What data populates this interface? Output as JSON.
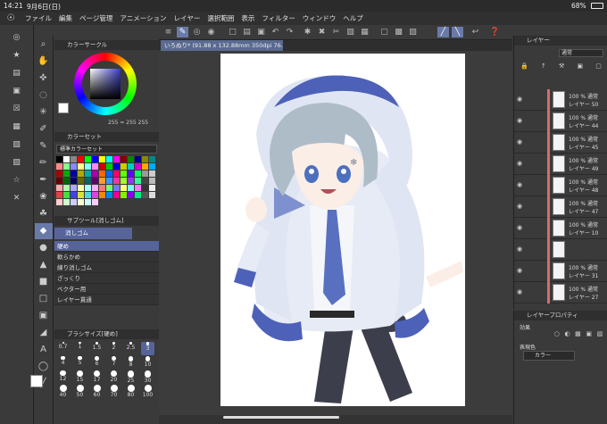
{
  "status": {
    "time": "14:21",
    "date": "9月6日(日)",
    "battery": "68%"
  },
  "menu": [
    "ファイル",
    "編集",
    "ページ管理",
    "アニメーション",
    "レイヤー",
    "選択範囲",
    "表示",
    "フィルター",
    "ウィンドウ",
    "ヘルプ"
  ],
  "doc_tab": "いろぬり* (91.88 x 132.88mm 350dpi 76.1%)",
  "panels": {
    "color_wheel": "カラーサークル",
    "color_values": {
      "h": "255",
      "s": "255",
      "v": "255"
    },
    "color_set": "カラーセット",
    "color_set_name": "標準カラーセット",
    "subtool_title": "サブツール[消しゴム]",
    "subtool_group": "消しゴム",
    "subtool_items": [
      "硬め",
      "軟らかめ",
      "練り消しゴム",
      "ざっくり",
      "ベクター用",
      "レイヤー貫通"
    ],
    "brush_size_title": "ブラシサイズ[硬め]",
    "brush_sizes": [
      "0.7",
      "1",
      "1.5",
      "2",
      "2.5",
      "3",
      "4",
      "5",
      "6",
      "7",
      "8",
      "10",
      "12",
      "15",
      "17",
      "20",
      "25",
      "30",
      "40",
      "50",
      "60",
      "70",
      "80",
      "100"
    ],
    "layer_title": "レイヤー",
    "blend_mode": "通常",
    "layers": [
      {
        "pct": "100 % 通常",
        "name": "レイヤー 50"
      },
      {
        "pct": "100 % 通常",
        "name": "レイヤー 44"
      },
      {
        "pct": "100 % 通常",
        "name": "レイヤー 45"
      },
      {
        "pct": "100 % 通常",
        "name": "レイヤー 49"
      },
      {
        "pct": "100 % 通常",
        "name": "レイヤー 48"
      },
      {
        "pct": "100 % 通常",
        "name": "レイヤー 47"
      },
      {
        "pct": "100 % 通常",
        "name": "レイヤー 10"
      },
      {
        "pct": "",
        "name": ""
      },
      {
        "pct": "100 % 通常",
        "name": "レイヤー 31"
      },
      {
        "pct": "100 % 通常",
        "name": "レイヤー 27"
      }
    ],
    "prop_title": "レイヤープロパティ",
    "prop_effect": "効果",
    "prop_expression": "表現色",
    "prop_color_value": "カラー"
  }
}
